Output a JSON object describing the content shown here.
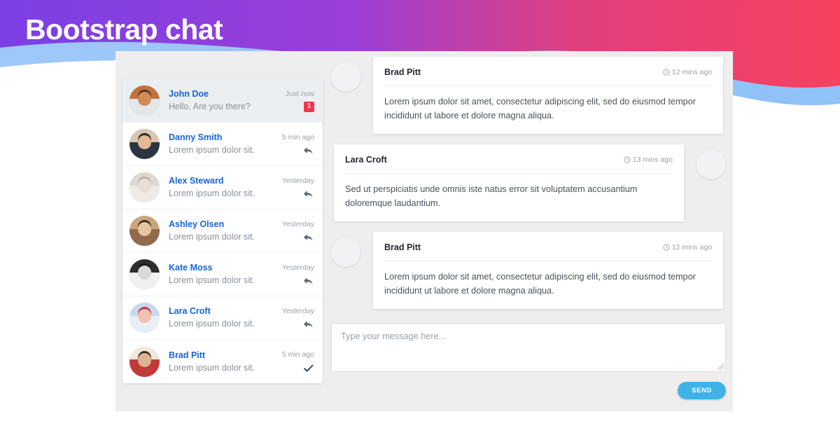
{
  "header": {
    "title": "Bootstrap chat",
    "gradient_from": "#7b3fe4",
    "gradient_to": "#f7415f",
    "wave_blue": "#8fc2f7"
  },
  "colors": {
    "panel_bg": "#eeeeee",
    "card_bg": "#ffffff",
    "name_link": "#1565d8",
    "muted_text": "#8a8f99",
    "badge_red": "#f4364c",
    "send_blue": "#3fb3e8"
  },
  "sidebar": {
    "items": [
      {
        "name": "John Doe",
        "preview": "Hello, Are you there?",
        "time": "Just now",
        "status": "badge",
        "badge": "1",
        "active": true,
        "avatar": "john-doe-avatar"
      },
      {
        "name": "Danny Smith",
        "preview": "Lorem ipsum dolor sit.",
        "time": "5 min ago",
        "status": "reply",
        "badge": "",
        "active": false,
        "avatar": "danny-smith-avatar"
      },
      {
        "name": "Alex Steward",
        "preview": "Lorem ipsum dolor sit.",
        "time": "Yesterday",
        "status": "reply",
        "badge": "",
        "active": false,
        "avatar": "alex-steward-avatar"
      },
      {
        "name": "Ashley Olsen",
        "preview": "Lorem ipsum dolor sit.",
        "time": "Yesterday",
        "status": "reply",
        "badge": "",
        "active": false,
        "avatar": "ashley-olsen-avatar"
      },
      {
        "name": "Kate Moss",
        "preview": "Lorem ipsum dolor sit.",
        "time": "Yesterday",
        "status": "reply",
        "badge": "",
        "active": false,
        "avatar": "kate-moss-avatar"
      },
      {
        "name": "Lara Croft",
        "preview": "Lorem ipsum dolor sit.",
        "time": "Yesterday",
        "status": "reply",
        "badge": "",
        "active": false,
        "avatar": "lara-croft-avatar"
      },
      {
        "name": "Brad Pitt",
        "preview": "Lorem ipsum dolor sit.",
        "time": "5 min ago",
        "status": "check",
        "badge": "",
        "active": false,
        "avatar": "brad-pitt-avatar"
      }
    ]
  },
  "conversation": {
    "messages": [
      {
        "name": "Brad Pitt",
        "time": "12 mins ago",
        "text": "Lorem ipsum dolor sit amet, consectetur adipiscing elit, sed do eiusmod tempor incididunt ut labore et dolore magna aliqua.",
        "direction": "incoming",
        "avatar": "brad-pitt-avatar"
      },
      {
        "name": "Lara Croft",
        "time": "13 mins ago",
        "text": "Sed ut perspiciatis unde omnis iste natus error sit voluptatem accusantium doloremque laudantium.",
        "direction": "outgoing",
        "avatar": "lara-croft-avatar"
      },
      {
        "name": "Brad Pitt",
        "time": "12 mins ago",
        "text": "Lorem ipsum dolor sit amet, consectetur adipiscing elit, sed do eiusmod tempor incididunt ut labore et dolore magna aliqua.",
        "direction": "incoming",
        "avatar": "brad-pitt-avatar"
      }
    ]
  },
  "composer": {
    "placeholder": "Type your message here...",
    "value": "",
    "send_label": "SEND"
  }
}
